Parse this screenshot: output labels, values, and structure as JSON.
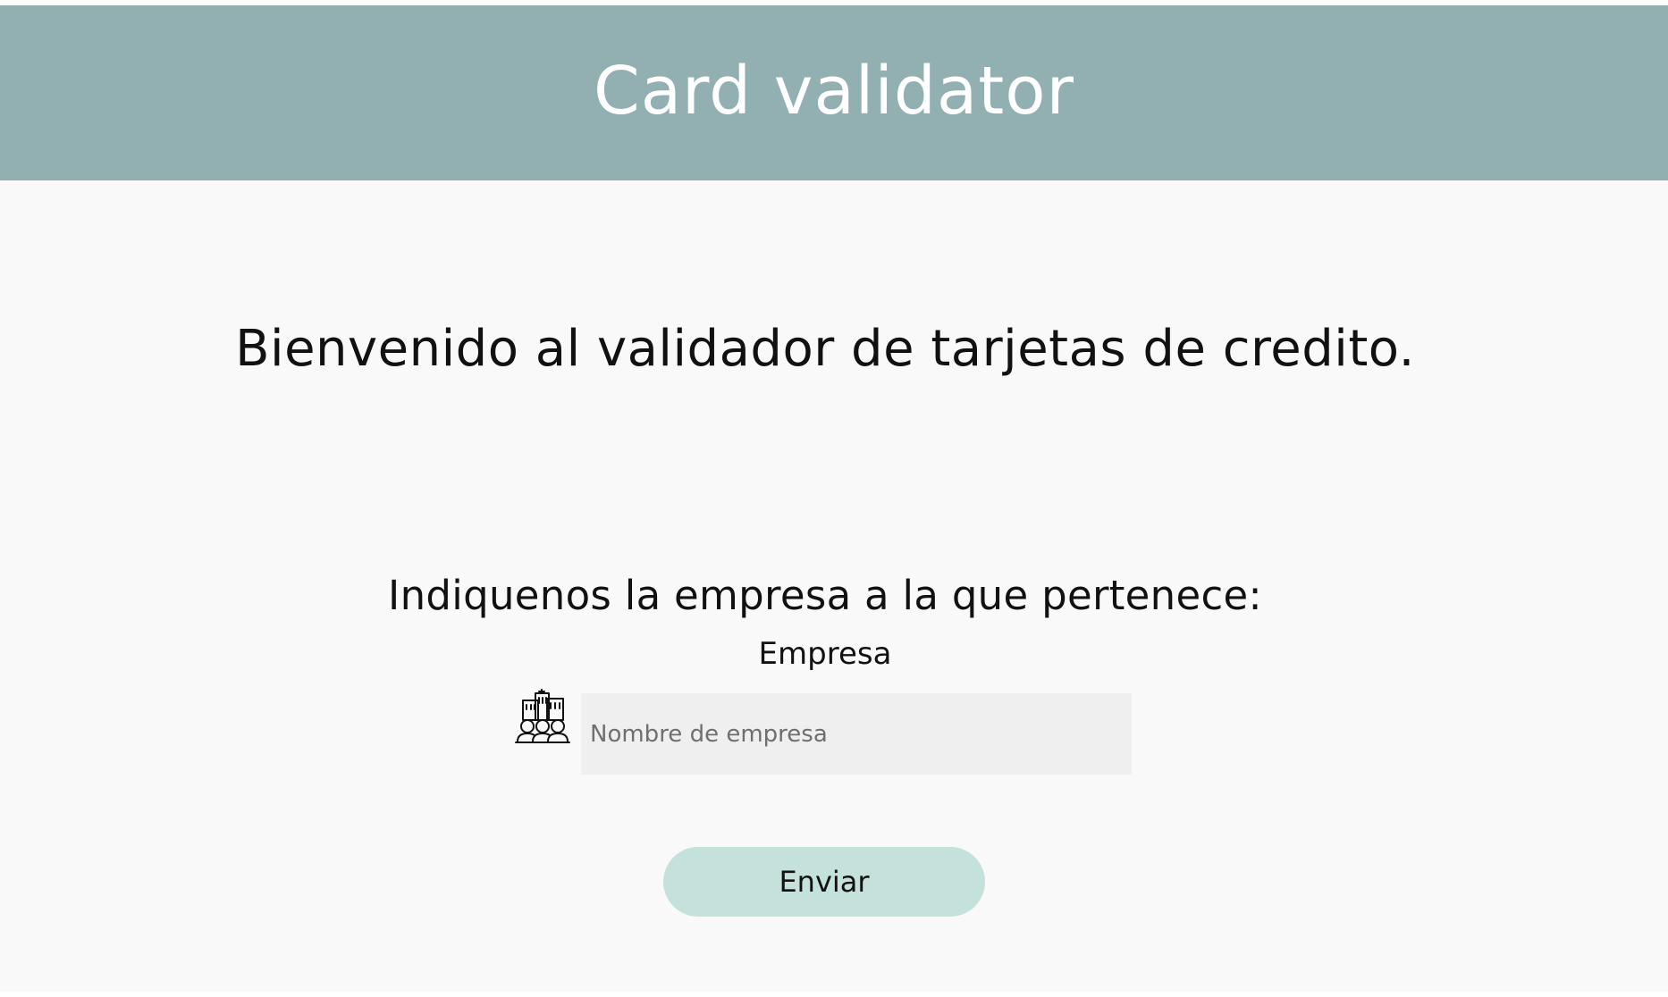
{
  "header": {
    "title": "Card validator"
  },
  "main": {
    "welcome_text": "Bienvenido al validador de tarjetas de credito.",
    "question_text": "Indiquenos la empresa a la que pertenece:",
    "company_field": {
      "label": "Empresa",
      "placeholder": "Nombre de empresa",
      "value": "",
      "icon": "building-people-icon"
    },
    "submit_label": "Enviar"
  },
  "colors": {
    "header_background": "#92b0b1",
    "header_text": "#ffffff",
    "page_background": "#f9f9f9",
    "input_background": "#efefef",
    "button_background": "#c5e1db"
  }
}
